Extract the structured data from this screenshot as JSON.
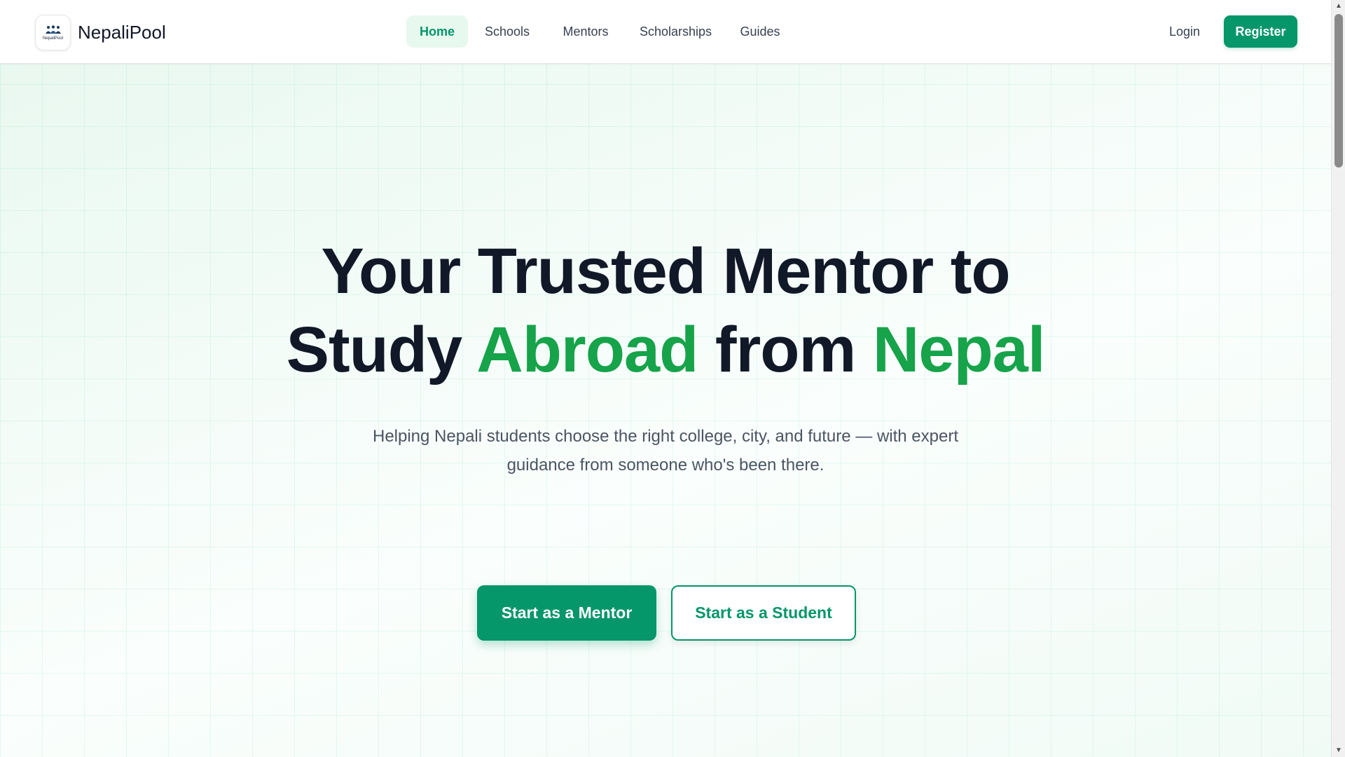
{
  "header": {
    "brand": {
      "name": "NepaliPool",
      "logo_text": "NepaliPool"
    },
    "nav": [
      {
        "label": "Home",
        "active": true
      },
      {
        "label": "Schools",
        "active": false
      },
      {
        "label": "Mentors",
        "active": false
      },
      {
        "label": "Scholarships",
        "active": false
      },
      {
        "label": "Guides",
        "active": false
      }
    ],
    "login_label": "Login",
    "register_label": "Register"
  },
  "hero": {
    "title_line1": "Your Trusted Mentor to",
    "title_study": "Study",
    "title_abroad": "Abroad",
    "title_from": "from",
    "title_nepal": "Nepal",
    "subtitle": "Helping Nepali students choose the right college, city, and future — with expert guidance from someone who's been there.",
    "cta_mentor": "Start as a Mentor",
    "cta_student": "Start as a Student"
  },
  "colors": {
    "accent": "#059669",
    "title_accent": "#16a34a",
    "text_dark": "#111827",
    "text_muted": "#4b5563",
    "active_nav_bg": "#e7f8ef"
  },
  "icons": {
    "scroll_up": "▲",
    "scroll_down": "▼"
  },
  "scroll": {
    "position_fraction": 0.0,
    "thumb_fraction_of_track": 0.21
  }
}
